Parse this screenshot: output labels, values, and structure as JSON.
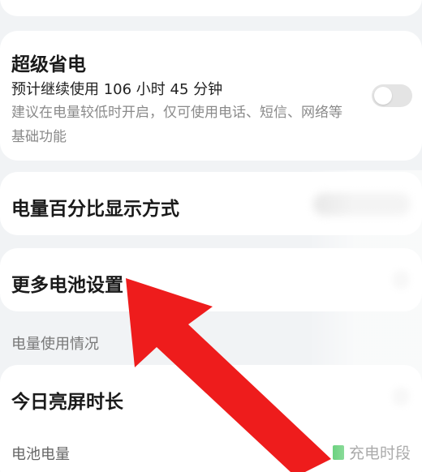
{
  "super_saver": {
    "title": "超级省电",
    "estimate": "预计继续使用 106 小时 45 分钟",
    "description": "建议在电量较低时开启，仅可使用电话、短信、网络等基础功能",
    "enabled": false
  },
  "percent_display": {
    "title": "电量百分比显示方式"
  },
  "more_battery": {
    "title": "更多电池设置"
  },
  "usage_section": {
    "header": "电量使用情况",
    "screen_time_title": "今日亮屏时长",
    "battery_level_label": "电池电量",
    "legend_label": "充电时段",
    "legend_color": "#2fbf4a"
  },
  "annotation": {
    "arrow_color": "#ee1c1c"
  }
}
